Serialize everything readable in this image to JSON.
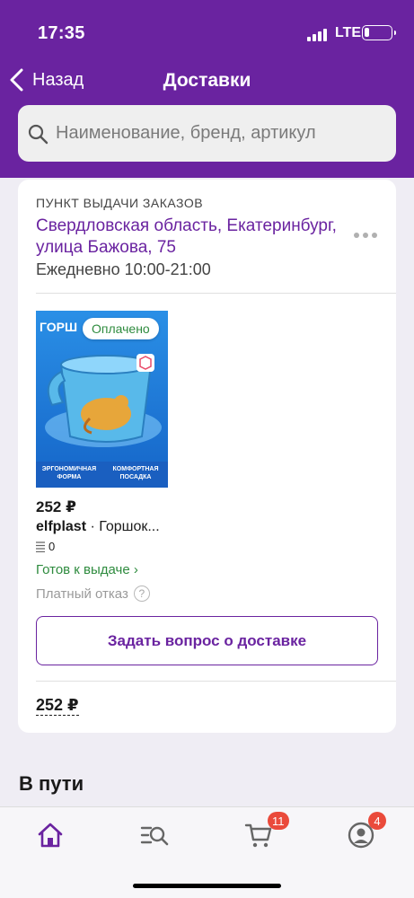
{
  "status_bar": {
    "time": "17:35",
    "network": "LTE"
  },
  "nav": {
    "back_label": "Назад",
    "title": "Доставки"
  },
  "search": {
    "placeholder": "Наименование, бренд, артикул"
  },
  "pickup": {
    "label": "ПУНКТ ВЫДАЧИ ЗАКАЗОВ",
    "address": "Свердловская область, Екатеринбург, улица Бажова, 75",
    "hours": "Ежедневно 10:00-21:00"
  },
  "product": {
    "status_badge": "Оплачено",
    "image_title": "ГОРШ",
    "image_caption_left": "ЭРГОНОМИЧНАЯ ФОРМА",
    "image_caption_right": "КОМФОРТНАЯ ПОСАДКА",
    "price": "252 ₽",
    "brand": "elfplast",
    "name": " · Горшок...",
    "quantity": "0",
    "ready_status": "Готов к выдаче ›",
    "paid_refusal": "Платный отказ",
    "help_symbol": "?"
  },
  "ask_button": "Задать вопрос о доставке",
  "total": "252 ₽",
  "section": {
    "in_transit": "В пути"
  },
  "tabbar": {
    "cart_badge": "11",
    "profile_badge": "4"
  },
  "colors": {
    "brand": "#6a23a0",
    "success": "#2e8b3e",
    "badge": "#ea4a3b"
  }
}
